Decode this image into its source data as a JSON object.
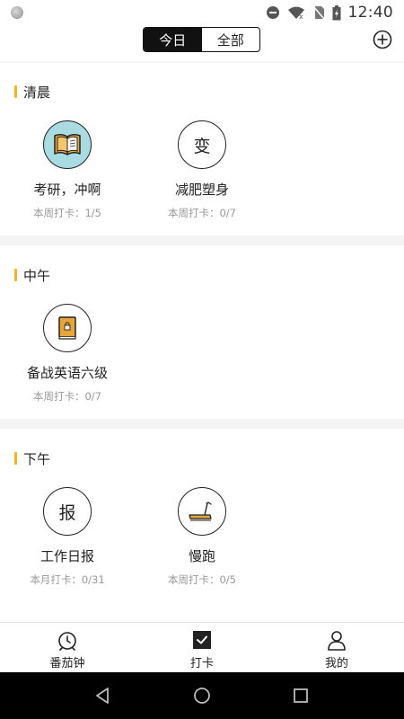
{
  "status_bar": {
    "time": "12:40"
  },
  "header": {
    "tabs": [
      {
        "label": "今日",
        "active": true
      },
      {
        "label": "全部",
        "active": false
      }
    ]
  },
  "sections": [
    {
      "title": "清晨",
      "habits": [
        {
          "name": "考研，冲啊",
          "stat": "本周打卡：1/5",
          "icon": "open-book-icon"
        },
        {
          "name": "减肥塑身",
          "stat": "本周打卡：0/7",
          "icon": "text-icon",
          "icon_text": "变"
        }
      ]
    },
    {
      "title": "中午",
      "habits": [
        {
          "name": "备战英语六级",
          "stat": "本周打卡：0/7",
          "icon": "locked-book-icon"
        }
      ]
    },
    {
      "title": "下午",
      "habits": [
        {
          "name": "工作日报",
          "stat": "本月打卡：0/31",
          "icon": "text-icon",
          "icon_text": "报"
        },
        {
          "name": "慢跑",
          "stat": "本周打卡：0/5",
          "icon": "treadmill-icon"
        }
      ]
    }
  ],
  "tabbar": [
    {
      "label": "番茄钟",
      "icon": "alarm-clock-icon"
    },
    {
      "label": "打卡",
      "icon": "checkbox-icon"
    },
    {
      "label": "我的",
      "icon": "person-icon"
    }
  ],
  "colors": {
    "accent": "#f0b429",
    "book_blue": "#a8dbe2",
    "book_orange": "#e8a63a"
  }
}
